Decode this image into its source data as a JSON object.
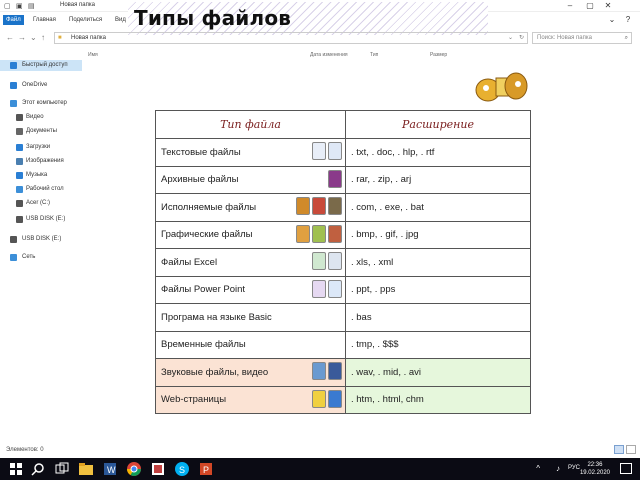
{
  "window": {
    "title": "Новая папка",
    "quick_access": [
      "▢",
      "▣",
      "▤"
    ]
  },
  "slide": {
    "title": "Типы файлов"
  },
  "ribbon": {
    "tabs": [
      "Файл",
      "Главная",
      "Поделиться",
      "Вид"
    ]
  },
  "address": {
    "path": "Новая папка",
    "search_placeholder": "Поиск: Новая папка"
  },
  "columns": [
    "Имя",
    "Дата изменения",
    "Тип",
    "Размер"
  ],
  "sidebar": {
    "items": [
      {
        "label": "Быстрый доступ",
        "icon": "star-icon",
        "color": "#2a7fd4"
      },
      {
        "label": "OneDrive",
        "icon": "cloud-icon",
        "color": "#2a7fd4"
      },
      {
        "label": "Этот компьютер",
        "icon": "computer-icon",
        "color": "#3c8fd8"
      },
      {
        "label": "Видео",
        "icon": "video-icon",
        "color": "#555555"
      },
      {
        "label": "Документы",
        "icon": "document-icon",
        "color": "#666666"
      },
      {
        "label": "Загрузки",
        "icon": "download-icon",
        "color": "#2a7fd4"
      },
      {
        "label": "Изображения",
        "icon": "image-icon",
        "color": "#4a7fb0"
      },
      {
        "label": "Музыка",
        "icon": "music-icon",
        "color": "#2a7fd4"
      },
      {
        "label": "Рабочий стол",
        "icon": "desktop-icon",
        "color": "#3c8fd8"
      },
      {
        "label": "Acer (C:)",
        "icon": "drive-icon",
        "color": "#555555"
      },
      {
        "label": "USB DISK (E:)",
        "icon": "usb-icon",
        "color": "#555555"
      },
      {
        "label": "USB DISK (E:)",
        "icon": "usb-icon",
        "color": "#555555"
      },
      {
        "label": "Сеть",
        "icon": "network-icon",
        "color": "#3c8fd8"
      }
    ]
  },
  "table": {
    "headers": [
      "Тип файла",
      "Расширение"
    ],
    "rows": [
      {
        "name": "Текстовые файлы",
        "ext": ". txt,  . doc,  . hlp,  . rtf",
        "icons": [
          "#e8eef8",
          "#dfe8f6"
        ]
      },
      {
        "name": "Архивные файлы",
        "ext": ". rar,   . zip,   . arj",
        "icons": [
          "#8a3a8a"
        ]
      },
      {
        "name": "Исполняемые   файлы",
        "ext": ". com,  . exe,  . bat",
        "icons": [
          "#d08a2a",
          "#c84a3a",
          "#7a6a4a"
        ]
      },
      {
        "name": "Графические  файлы",
        "ext": ". bmp,  . gif,   . jpg",
        "icons": [
          "#e0a040",
          "#a0c050",
          "#c06040"
        ]
      },
      {
        "name": "Файлы  Excel",
        "ext": ". xls,  . xml",
        "icons": [
          "#d0e8d0",
          "#dde5f0"
        ]
      },
      {
        "name": "Файлы  Power Point",
        "ext": ". ppt,  . pps",
        "icons": [
          "#e6d9f2",
          "#dce8f8"
        ]
      },
      {
        "name": "Програма на языке Basic",
        "ext": ". bas",
        "icons": []
      },
      {
        "name": "Временные файлы",
        "ext": ". tmp,  . $$$",
        "icons": []
      },
      {
        "name": "Звуковые файлы, видео",
        "ext": ". wav,   . mid,    . avi",
        "icons": [
          "#6a9ad0",
          "#3a5a9a"
        ]
      },
      {
        "name": "Web-страницы",
        "ext": ". htm,  . html,   chm",
        "icons": [
          "#f0d040",
          "#3a7ad0"
        ]
      }
    ]
  },
  "status": {
    "text": "Элементов: 0"
  },
  "taskbar": {
    "lang": "РУС",
    "time": "22:36",
    "date": "19.02.2020"
  }
}
